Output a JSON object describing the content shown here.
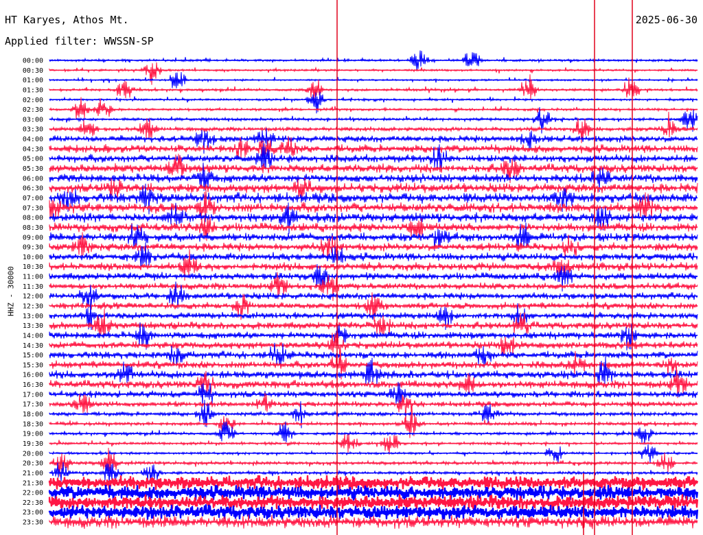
{
  "header": {
    "station": "HT Karyes, Athos Mt.",
    "date": "2025-06-30",
    "filter": "Applied filter: WWSSN-SP"
  },
  "chart_data": {
    "type": "line",
    "title": "HT Karyes, Athos Mt.",
    "ylabel": "HHZ - 30000",
    "colors": [
      "#0000ff",
      "#ff1744"
    ],
    "rows": [
      {
        "time": "00:00",
        "activity": 0.1,
        "bursts": [
          610,
          688
        ]
      },
      {
        "time": "00:30",
        "activity": 0.07,
        "bursts": [
          222
        ]
      },
      {
        "time": "01:00",
        "activity": 0.06,
        "bursts": [
          258
        ]
      },
      {
        "time": "01:30",
        "activity": 0.12,
        "bursts": [
          182,
          460,
          770,
          920
        ]
      },
      {
        "time": "02:00",
        "activity": 0.08,
        "bursts": [
          460
        ]
      },
      {
        "time": "02:30",
        "activity": 0.12,
        "bursts": [
          118,
          150
        ]
      },
      {
        "time": "03:00",
        "activity": 0.15,
        "bursts": [
          790,
          1005
        ]
      },
      {
        "time": "03:30",
        "activity": 0.25,
        "bursts": [
          128,
          215,
          848,
          975
        ]
      },
      {
        "time": "04:00",
        "activity": 0.45,
        "bursts": [
          298,
          385,
          770
        ]
      },
      {
        "time": "04:30",
        "activity": 0.55,
        "bursts": [
          348,
          385,
          420
        ]
      },
      {
        "time": "05:00",
        "activity": 0.55,
        "bursts": [
          385,
          640
        ]
      },
      {
        "time": "05:30",
        "activity": 0.6,
        "bursts": [
          258,
          745
        ]
      },
      {
        "time": "06:00",
        "activity": 0.6,
        "bursts": [
          298,
          875
        ]
      },
      {
        "time": "06:30",
        "activity": 0.65,
        "bursts": [
          165,
          440
        ]
      },
      {
        "time": "07:00",
        "activity": 0.7,
        "bursts": [
          100,
          215,
          820
        ]
      },
      {
        "time": "07:30",
        "activity": 0.7,
        "bursts": [
          80,
          300,
          940
        ]
      },
      {
        "time": "08:00",
        "activity": 0.65,
        "bursts": [
          258,
          420,
          880
        ]
      },
      {
        "time": "08:30",
        "activity": 0.6,
        "bursts": [
          300,
          608
        ]
      },
      {
        "time": "09:00",
        "activity": 0.6,
        "bursts": [
          200,
          640,
          760
        ]
      },
      {
        "time": "09:30",
        "activity": 0.55,
        "bursts": [
          120,
          480,
          830
        ]
      },
      {
        "time": "10:00",
        "activity": 0.55,
        "bursts": [
          210,
          490
        ]
      },
      {
        "time": "10:30",
        "activity": 0.55,
        "bursts": [
          275,
          820
        ]
      },
      {
        "time": "11:00",
        "activity": 0.5,
        "bursts": [
          465,
          820
        ]
      },
      {
        "time": "11:30",
        "activity": 0.45,
        "bursts": [
          408,
          480
        ]
      },
      {
        "time": "12:00",
        "activity": 0.45,
        "bursts": [
          128,
          258
        ]
      },
      {
        "time": "12:30",
        "activity": 0.45,
        "bursts": [
          350,
          545
        ]
      },
      {
        "time": "13:00",
        "activity": 0.45,
        "bursts": [
          130,
          650,
          760
        ]
      },
      {
        "time": "13:30",
        "activity": 0.5,
        "bursts": [
          148,
          560,
          760
        ]
      },
      {
        "time": "14:00",
        "activity": 0.5,
        "bursts": [
          210,
          495,
          915
        ]
      },
      {
        "time": "14:30",
        "activity": 0.5,
        "bursts": [
          490,
          740
        ]
      },
      {
        "time": "15:00",
        "activity": 0.5,
        "bursts": [
          258,
          405,
          705
        ]
      },
      {
        "time": "15:30",
        "activity": 0.5,
        "bursts": [
          495,
          840,
          975
        ]
      },
      {
        "time": "16:00",
        "activity": 0.55,
        "bursts": [
          180,
          540,
          880
        ]
      },
      {
        "time": "16:30",
        "activity": 0.55,
        "bursts": [
          300,
          680,
          990
        ]
      },
      {
        "time": "17:00",
        "activity": 0.45,
        "bursts": [
          300,
          578
        ]
      },
      {
        "time": "17:30",
        "activity": 0.35,
        "bursts": [
          120,
          385,
          590
        ]
      },
      {
        "time": "18:00",
        "activity": 0.25,
        "bursts": [
          298,
          438,
          712
        ]
      },
      {
        "time": "18:30",
        "activity": 0.18,
        "bursts": [
          330,
          600
        ]
      },
      {
        "time": "19:00",
        "activity": 0.15,
        "bursts": [
          330,
          415,
          938
        ]
      },
      {
        "time": "19:30",
        "activity": 0.12,
        "bursts": [
          510,
          568
        ]
      },
      {
        "time": "20:00",
        "activity": 0.12,
        "bursts": [
          808,
          945
        ]
      },
      {
        "time": "20:30",
        "activity": 0.18,
        "bursts": [
          90,
          158,
          968
        ]
      },
      {
        "time": "21:00",
        "activity": 0.15,
        "bursts": [
          88,
          160,
          220
        ]
      },
      {
        "time": "21:30",
        "activity": 0.95,
        "bursts": []
      },
      {
        "time": "22:00",
        "activity": 1.0,
        "bursts": []
      },
      {
        "time": "22:30",
        "activity": 1.0,
        "bursts": []
      },
      {
        "time": "23:00",
        "activity": 1.0,
        "bursts": []
      },
      {
        "time": "23:30",
        "activity": 0.9,
        "bursts": []
      }
    ]
  }
}
